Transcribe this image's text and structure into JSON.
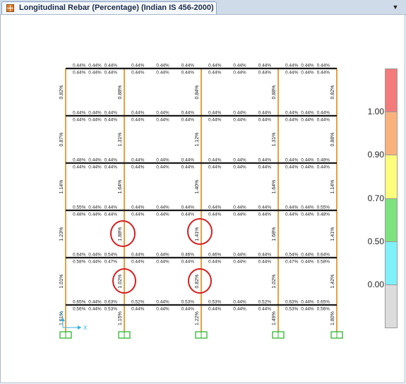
{
  "tab": {
    "title": "Longitudinal Rebar (Percentage)  (Indian IS 456-2000)",
    "icon": "frame-icon",
    "dropdown_icon": "chevron-down-icon"
  },
  "legend": {
    "ticks": [
      {
        "label": "1.00"
      },
      {
        "label": "0.90"
      },
      {
        "label": "0.70"
      },
      {
        "label": "0.50"
      },
      {
        "label": "0.00"
      }
    ],
    "colors": [
      "#f47b7b",
      "#f9b27c",
      "#fdfd7c",
      "#7ee27e",
      "#7ef1fb",
      "#dcdcdc"
    ]
  },
  "axes": {
    "x_label": "X",
    "z_label": "Z"
  },
  "columns": {
    "col0": [
      "0.82%",
      "0.87%",
      "1.14%",
      "1.23%",
      "1.01%",
      "1.51%"
    ],
    "col1": [
      "0.88%",
      "1.31%",
      "1.64%",
      "1.88%",
      "1.02%",
      "1.15%"
    ],
    "col2": [
      "0.84%",
      "1.12%",
      "1.40%",
      "1.41%",
      "0.82%",
      "1.22%"
    ],
    "col3": [
      "0.88%",
      "1.31%",
      "1.64%",
      "1.68%",
      "1.02%",
      "1.49%"
    ],
    "col4": [
      "0.82%",
      "0.88%",
      "1.14%",
      "1.41%",
      "1.42%",
      "1.80%"
    ]
  },
  "beams": {
    "r0": {
      "top": [
        [
          "0.44%",
          "0.44%",
          "0.44%"
        ],
        [
          "0.44%",
          "0.44%",
          "0.44%"
        ],
        [
          "0.44%",
          "0.44%",
          "0.44%"
        ],
        [
          "0.44%",
          "0.44%",
          "0.44%"
        ]
      ],
      "bot": [
        [
          "0.44%",
          "0.44%",
          "0.44%"
        ],
        [
          "0.44%",
          "0.44%",
          "0.44%"
        ],
        [
          "0.44%",
          "0.44%",
          "0.44%"
        ],
        [
          "0.44%",
          "0.44%",
          "0.44%"
        ]
      ]
    },
    "r1": {
      "top": [
        [
          "0.44%",
          "0.44%",
          "0.44%"
        ],
        [
          "0.44%",
          "0.44%",
          "0.44%"
        ],
        [
          "0.44%",
          "0.44%",
          "0.44%"
        ],
        [
          "0.44%",
          "0.44%",
          "0.44%"
        ]
      ],
      "bot": [
        [
          "0.44%",
          "0.44%",
          "0.44%"
        ],
        [
          "0.44%",
          "0.44%",
          "0.44%"
        ],
        [
          "0.44%",
          "0.44%",
          "0.44%"
        ],
        [
          "0.44%",
          "0.44%",
          "0.44%"
        ]
      ]
    },
    "r2": {
      "top": [
        [
          "0.48%",
          "0.44%",
          "0.44%"
        ],
        [
          "0.44%",
          "0.44%",
          "0.44%"
        ],
        [
          "0.44%",
          "0.44%",
          "0.44%"
        ],
        [
          "0.44%",
          "0.44%",
          "0.48%"
        ]
      ],
      "bot": [
        [
          "0.44%",
          "0.44%",
          "0.44%"
        ],
        [
          "0.44%",
          "0.44%",
          "0.44%"
        ],
        [
          "0.44%",
          "0.44%",
          "0.44%"
        ],
        [
          "0.44%",
          "0.44%",
          "0.44%"
        ]
      ]
    },
    "r3": {
      "top": [
        [
          "0.55%",
          "0.44%",
          "0.44%"
        ],
        [
          "0.44%",
          "0.44%",
          "0.44%"
        ],
        [
          "0.44%",
          "0.44%",
          "0.44%"
        ],
        [
          "0.44%",
          "0.44%",
          "0.55%"
        ]
      ],
      "bot": [
        [
          "0.48%",
          "0.44%",
          "0.44%"
        ],
        [
          "0.44%",
          "0.44%",
          "0.44%"
        ],
        [
          "0.44%",
          "0.44%",
          "0.44%"
        ],
        [
          "0.44%",
          "0.44%",
          "0.48%"
        ]
      ]
    },
    "r4": {
      "top": [
        [
          "0.64%",
          "0.44%",
          "0.54%"
        ],
        [
          "0.44%",
          "0.44%",
          "0.46%"
        ],
        [
          "0.46%",
          "0.44%",
          "0.44%"
        ],
        [
          "0.54%",
          "0.44%",
          "0.64%"
        ]
      ],
      "bot": [
        [
          "0.58%",
          "0.44%",
          "0.47%"
        ],
        [
          "0.44%",
          "0.44%",
          "0.44%"
        ],
        [
          "0.44%",
          "0.44%",
          "0.44%"
        ],
        [
          "0.47%",
          "0.44%",
          "0.58%"
        ]
      ]
    },
    "r5": {
      "top": [
        [
          "0.65%",
          "0.44%",
          "0.63%"
        ],
        [
          "0.52%",
          "0.44%",
          "0.53%"
        ],
        [
          "0.53%",
          "0.44%",
          "0.52%"
        ],
        [
          "0.63%",
          "0.44%",
          "0.65%"
        ]
      ],
      "bot": [
        [
          "0.56%",
          "0.44%",
          "0.53%"
        ],
        [
          "0.44%",
          "0.44%",
          "0.44%"
        ],
        [
          "0.44%",
          "0.44%",
          "0.44%"
        ],
        [
          "0.53%",
          "0.44%",
          "0.56%"
        ]
      ]
    }
  },
  "colors": {
    "beam": "#1a1a1a",
    "column": "#e8a040",
    "support": "#2fb52f",
    "markup": "#d42020",
    "axis": "#30b0e0"
  }
}
